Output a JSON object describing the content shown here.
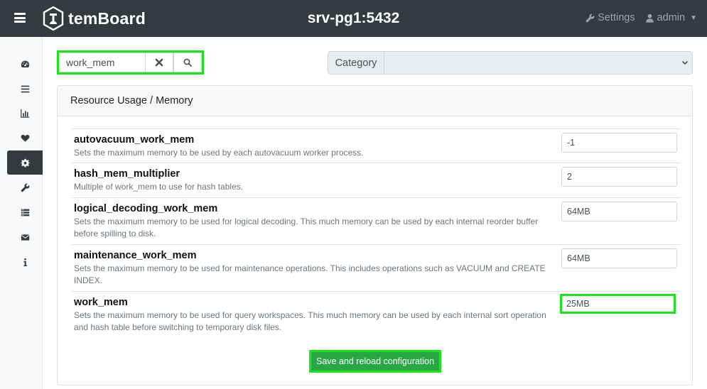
{
  "header": {
    "brand": "temBoard",
    "server": "srv-pg1:5432",
    "settings_label": "Settings",
    "user_label": "admin"
  },
  "sidebar": {
    "items": [
      {
        "icon": "dashboard-icon"
      },
      {
        "icon": "list-icon"
      },
      {
        "icon": "chart-icon"
      },
      {
        "icon": "heart-icon"
      },
      {
        "icon": "gear-icon",
        "active": true
      },
      {
        "icon": "wrench-icon"
      },
      {
        "icon": "server-icon"
      },
      {
        "icon": "envelope-icon"
      },
      {
        "icon": "info-icon"
      }
    ]
  },
  "search": {
    "value": "work_mem"
  },
  "category": {
    "label": "Category",
    "selected": ""
  },
  "card": {
    "title": "Resource Usage / Memory",
    "rows": [
      {
        "name": "autovacuum_work_mem",
        "description": "Sets the maximum memory to be used by each autovacuum worker process.",
        "value": "-1"
      },
      {
        "name": "hash_mem_multiplier",
        "description": "Multiple of work_mem to use for hash tables.",
        "value": "2"
      },
      {
        "name": "logical_decoding_work_mem",
        "description": "Sets the maximum memory to be used for logical decoding. This much memory can be used by each internal reorder buffer before spilling to disk.",
        "value": "64MB"
      },
      {
        "name": "maintenance_work_mem",
        "description": "Sets the maximum memory to be used for maintenance operations. This includes operations such as VACUUM and CREATE INDEX.",
        "value": "64MB"
      },
      {
        "name": "work_mem",
        "description": "Sets the maximum memory to be used for query workspaces. This much memory can be used by each internal sort operation and hash table before switching to temporary disk files.",
        "value": "25MB"
      }
    ],
    "save_label": "Save and reload configuration"
  },
  "colors": {
    "topbar": "#343a40",
    "highlight": "#20e020",
    "save_button": "#28a745"
  }
}
